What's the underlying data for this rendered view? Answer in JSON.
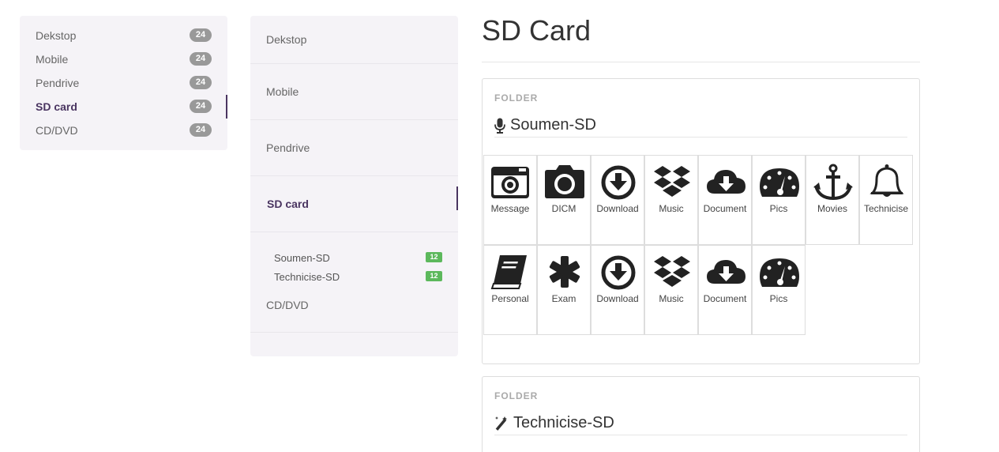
{
  "left_nav": {
    "items": [
      {
        "label": "Dekstop",
        "badge": "24"
      },
      {
        "label": "Mobile",
        "badge": "24"
      },
      {
        "label": "Pendrive",
        "badge": "24"
      },
      {
        "label": "SD card",
        "badge": "24",
        "active": true
      },
      {
        "label": "CD/DVD",
        "badge": "24"
      }
    ]
  },
  "mid_nav": {
    "items": [
      {
        "label": "Dekstop"
      },
      {
        "label": "Mobile"
      },
      {
        "label": "Pendrive"
      },
      {
        "label": "SD card",
        "active": true
      },
      {
        "label": "CD/DVD"
      }
    ],
    "sub_items": [
      {
        "label": "Soumen-SD",
        "badge": "12"
      },
      {
        "label": "Technicise-SD",
        "badge": "12"
      }
    ]
  },
  "main": {
    "title": "SD Card",
    "folders": [
      {
        "kicker": "FOLDER",
        "name": "Soumen-SD",
        "icon": "microphone-icon",
        "tiles": [
          {
            "label": "Message",
            "icon": "camera-retro-icon"
          },
          {
            "label": "DICM",
            "icon": "camera-icon"
          },
          {
            "label": "Download",
            "icon": "download-icon"
          },
          {
            "label": "Music",
            "icon": "dropbox-icon"
          },
          {
            "label": "Document",
            "icon": "cloud-download-icon"
          },
          {
            "label": "Pics",
            "icon": "dashboard-icon"
          },
          {
            "label": "Movies",
            "icon": "anchor-icon"
          },
          {
            "label": "Technicise",
            "icon": "bell-icon"
          },
          {
            "label": "Personal",
            "icon": "book-icon"
          },
          {
            "label": "Exam",
            "icon": "asterisk-icon"
          },
          {
            "label": "Download",
            "icon": "download-icon"
          },
          {
            "label": "Music",
            "icon": "dropbox-icon"
          },
          {
            "label": "Document",
            "icon": "cloud-download-icon"
          },
          {
            "label": "Pics",
            "icon": "dashboard-icon"
          }
        ]
      },
      {
        "kicker": "FOLDER",
        "name": "Technicise-SD",
        "icon": "magic-wand-icon"
      }
    ]
  }
}
